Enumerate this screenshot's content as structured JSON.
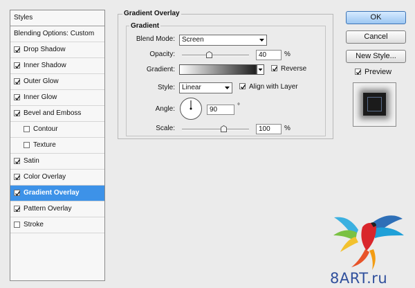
{
  "styles_list": {
    "header": "Styles",
    "blending": "Blending Options: Custom",
    "items": [
      {
        "label": "Drop Shadow",
        "checked": true,
        "indent": false,
        "active": false
      },
      {
        "label": "Inner Shadow",
        "checked": true,
        "indent": false,
        "active": false
      },
      {
        "label": "Outer Glow",
        "checked": true,
        "indent": false,
        "active": false
      },
      {
        "label": "Inner Glow",
        "checked": true,
        "indent": false,
        "active": false
      },
      {
        "label": "Bevel and Emboss",
        "checked": true,
        "indent": false,
        "active": false
      },
      {
        "label": "Contour",
        "checked": false,
        "indent": true,
        "active": false
      },
      {
        "label": "Texture",
        "checked": false,
        "indent": true,
        "active": false
      },
      {
        "label": "Satin",
        "checked": true,
        "indent": false,
        "active": false
      },
      {
        "label": "Color Overlay",
        "checked": true,
        "indent": false,
        "active": false
      },
      {
        "label": "Gradient Overlay",
        "checked": true,
        "indent": false,
        "active": true
      },
      {
        "label": "Pattern Overlay",
        "checked": true,
        "indent": false,
        "active": false
      },
      {
        "label": "Stroke",
        "checked": false,
        "indent": false,
        "active": false
      }
    ]
  },
  "panel": {
    "title": "Gradient Overlay",
    "subtitle": "Gradient",
    "blend_mode_label": "Blend Mode:",
    "blend_mode_value": "Screen",
    "opacity_label": "Opacity:",
    "opacity_value": "40",
    "opacity_unit": "%",
    "opacity_fraction": 0.4,
    "gradient_label": "Gradient:",
    "reverse_label": "Reverse",
    "reverse_checked": true,
    "style_label": "Style:",
    "style_value": "Linear",
    "align_label": "Align with Layer",
    "align_checked": true,
    "angle_label": "Angle:",
    "angle_value": "90",
    "angle_unit": "°",
    "scale_label": "Scale:",
    "scale_value": "100",
    "scale_unit": "%"
  },
  "buttons": {
    "ok": "OK",
    "cancel": "Cancel",
    "new_style": "New Style..."
  },
  "preview": {
    "label": "Preview",
    "checked": true
  },
  "watermark": "8ART.ru",
  "colors": {
    "accent": "#3d92e8",
    "background": "#ebebeb"
  }
}
